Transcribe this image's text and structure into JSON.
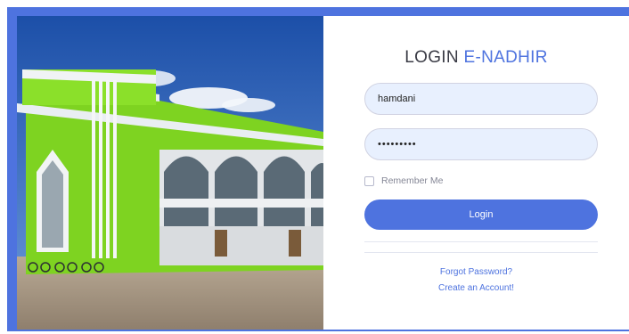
{
  "login": {
    "title_prefix": "LOGIN",
    "title_brand": "E-NADHIR",
    "username_value": "hamdani",
    "password_value": "•••••••••",
    "remember_label": "Remember Me",
    "remember_checked": false,
    "login_button": "Login",
    "forgot_password": "Forgot Password?",
    "create_account": "Create an Account!"
  },
  "colors": {
    "accent": "#4e73df",
    "input_bg": "#e8f0fe",
    "building_green": "#7ed321"
  }
}
